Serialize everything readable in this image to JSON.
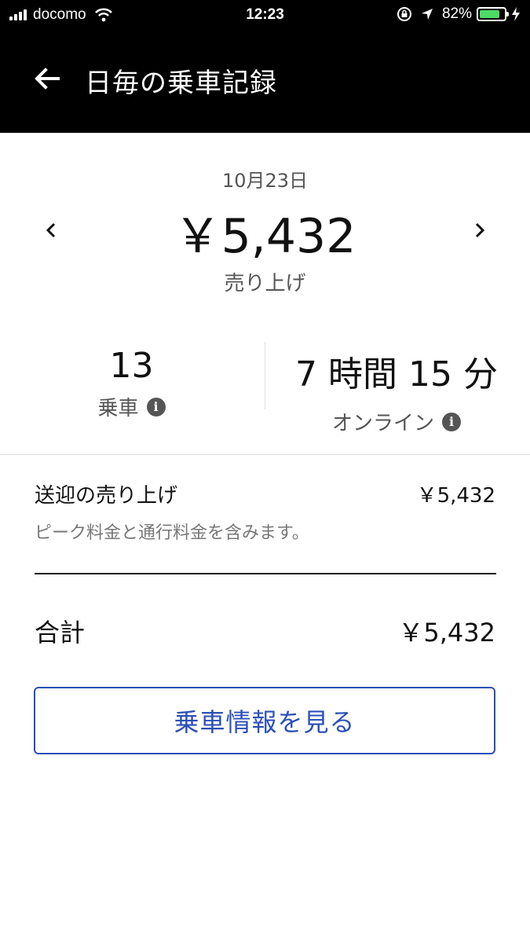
{
  "status_bar": {
    "carrier": "docomo",
    "time": "12:23",
    "battery_percent": "82%",
    "battery_level": 0.82
  },
  "header": {
    "title": "日毎の乗車記録",
    "back_icon": "arrow-left-icon"
  },
  "summary": {
    "date": "10月23日",
    "amount": "￥5,432",
    "amount_label": "売り上げ"
  },
  "stats": {
    "trips_value": "13",
    "trips_label": "乗車",
    "online_value": "7 時間 15 分",
    "online_label": "オンライン"
  },
  "breakdown": {
    "fare_label": "送迎の売り上げ",
    "fare_value": "￥5,432",
    "fare_note": "ピーク料金と通行料金を含みます。",
    "total_label": "合計",
    "total_value": "￥5,432"
  },
  "actions": {
    "view_trips": "乗車情報を見る"
  },
  "colors": {
    "header_bg": "#000000",
    "accent": "#2b4fb8",
    "battery_green": "#4cd964"
  }
}
